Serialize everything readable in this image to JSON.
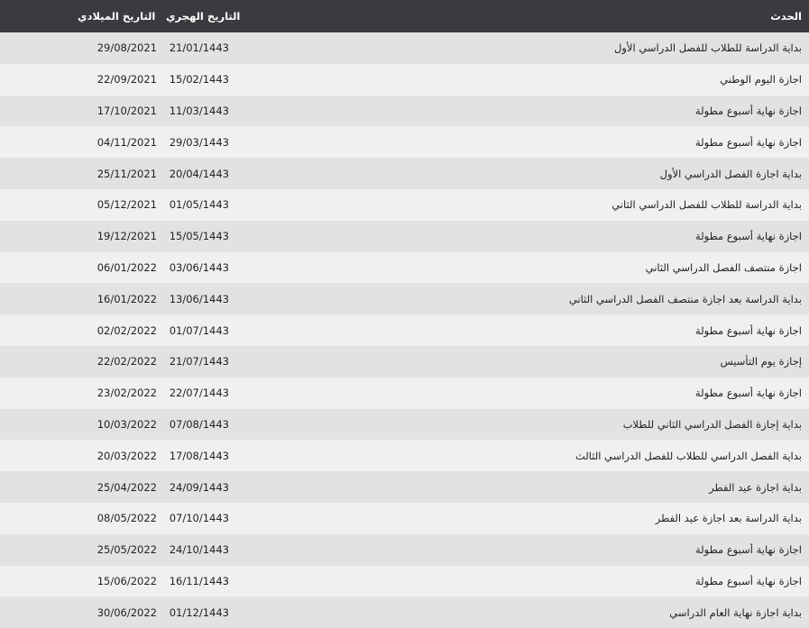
{
  "table": {
    "headers": {
      "event": "الحدث",
      "hijri": "التاريخ الهجري",
      "gregorian": "التاريخ الميلادي"
    },
    "rows": [
      {
        "event": "بداية الدراسة للطلاب للفصل الدراسي الأول",
        "hijri": "21/01/1443",
        "gregorian": "29/08/2021"
      },
      {
        "event": "اجازة اليوم الوطني",
        "hijri": "15/02/1443",
        "gregorian": "22/09/2021"
      },
      {
        "event": "اجازة نهاية أسبوع مطولة",
        "hijri": "11/03/1443",
        "gregorian": "17/10/2021"
      },
      {
        "event": "اجازة نهاية أسبوع مطولة",
        "hijri": "29/03/1443",
        "gregorian": "04/11/2021"
      },
      {
        "event": "بداية اجازة الفصل الدراسي الأول",
        "hijri": "20/04/1443",
        "gregorian": "25/11/2021"
      },
      {
        "event": "بداية الدراسة للطلاب للفصل الدراسي الثاني",
        "hijri": "01/05/1443",
        "gregorian": "05/12/2021"
      },
      {
        "event": "اجازة نهاية أسبوع مطولة",
        "hijri": "15/05/1443",
        "gregorian": "19/12/2021"
      },
      {
        "event": "اجازة منتصف الفصل الدراسي الثاني",
        "hijri": "03/06/1443",
        "gregorian": "06/01/2022"
      },
      {
        "event": "بداية الدراسة بعد اجازة منتصف الفصل الدراسي الثاني",
        "hijri": "13/06/1443",
        "gregorian": "16/01/2022"
      },
      {
        "event": "اجازة نهاية أسبوع مطولة",
        "hijri": "01/07/1443",
        "gregorian": "02/02/2022"
      },
      {
        "event": "إجازة يوم التأسيس",
        "hijri": "21/07/1443",
        "gregorian": "22/02/2022"
      },
      {
        "event": "اجازة نهاية أسبوع مطولة",
        "hijri": "22/07/1443",
        "gregorian": "23/02/2022"
      },
      {
        "event": "بداية إجازة الفصل الدراسي الثاني للطلاب",
        "hijri": "07/08/1443",
        "gregorian": "10/03/2022"
      },
      {
        "event": "بداية الفصل الدراسي للطلاب للفصل الدراسي الثالث",
        "hijri": "17/08/1443",
        "gregorian": "20/03/2022"
      },
      {
        "event": "بداية اجازة عيد الفطر",
        "hijri": "24/09/1443",
        "gregorian": "25/04/2022"
      },
      {
        "event": "بداية الدراسة بعد اجازة عيد الفطر",
        "hijri": "07/10/1443",
        "gregorian": "08/05/2022"
      },
      {
        "event": "اجازة نهاية أسبوع مطولة",
        "hijri": "24/10/1443",
        "gregorian": "25/05/2022"
      },
      {
        "event": "اجازة نهاية أسبوع مطولة",
        "hijri": "16/11/1443",
        "gregorian": "15/06/2022"
      },
      {
        "event": "بداية اجازة نهاية العام الدراسي",
        "hijri": "01/12/1443",
        "gregorian": "30/06/2022"
      }
    ]
  }
}
